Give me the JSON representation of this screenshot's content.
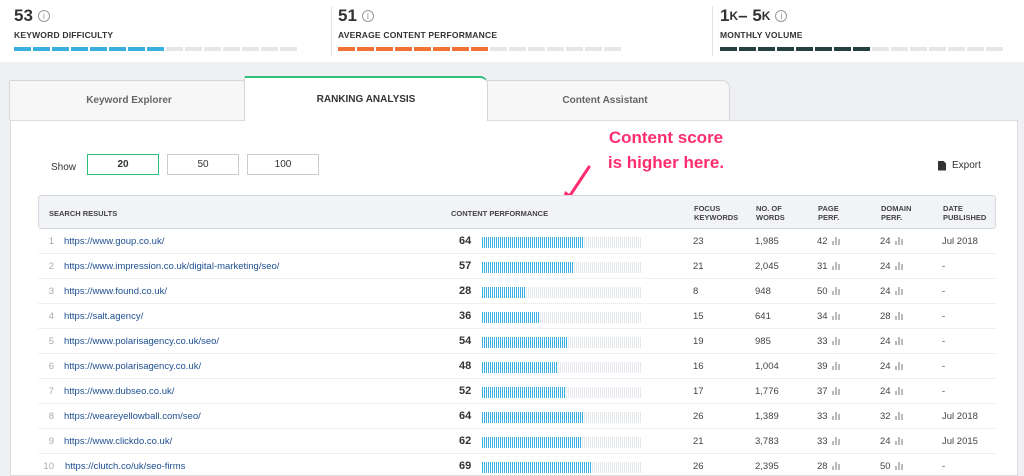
{
  "metrics": [
    {
      "value": "53",
      "label": "KEYWORD DIFFICULTY",
      "color": "#3ab0e0",
      "filled": 8,
      "total": 15
    },
    {
      "value": "51",
      "label": "AVERAGE CONTENT PERFORMANCE",
      "color": "#f07234",
      "filled": 8,
      "total": 15
    },
    {
      "value_main": "1",
      "value_unit_a": "K",
      "value_sep": " – 5",
      "value_unit_b": "K",
      "label": "MONTHLY VOLUME",
      "color": "#254143",
      "filled": 8,
      "total": 15
    }
  ],
  "tabs": {
    "keyword_explorer": "Keyword Explorer",
    "ranking_analysis": "RANKING ANALYSIS",
    "content_assistant": "Content Assistant"
  },
  "show": {
    "label": "Show",
    "options": [
      "20",
      "50",
      "100"
    ],
    "selected": "20"
  },
  "export_label": "Export",
  "annotation": {
    "line1": "Content score",
    "line2": "is higher here."
  },
  "columns": {
    "search_results": "SEARCH RESULTS",
    "content_performance": "CONTENT PERFORMANCE",
    "focus_keywords": "FOCUS KEYWORDS",
    "no_of_words": "NO. OF WORDS",
    "page_perf": "PAGE PERF.",
    "domain_perf": "DOMAIN PERF.",
    "date_published": "DATE PUBLISHED"
  },
  "colors": {
    "accent": "#2ebd7b",
    "bar": "#3ab0e0",
    "bar_empty": "#e4e8ec",
    "annotation": "#ff2d6f"
  },
  "rows": [
    {
      "rank": "1",
      "url": "https://www.goup.co.uk/",
      "score": "64",
      "focus": "23",
      "words": "1,985",
      "page": "42",
      "domain": "24",
      "date": "Jul 2018"
    },
    {
      "rank": "2",
      "url": "https://www.impression.co.uk/digital-marketing/seo/",
      "score": "57",
      "focus": "21",
      "words": "2,045",
      "page": "31",
      "domain": "24",
      "date": "-"
    },
    {
      "rank": "3",
      "url": "https://www.found.co.uk/",
      "score": "28",
      "focus": "8",
      "words": "948",
      "page": "50",
      "domain": "24",
      "date": "-"
    },
    {
      "rank": "4",
      "url": "https://salt.agency/",
      "score": "36",
      "focus": "15",
      "words": "641",
      "page": "34",
      "domain": "28",
      "date": "-"
    },
    {
      "rank": "5",
      "url": "https://www.polarisagency.co.uk/seo/",
      "score": "54",
      "focus": "19",
      "words": "985",
      "page": "33",
      "domain": "24",
      "date": "-"
    },
    {
      "rank": "6",
      "url": "https://www.polarisagency.co.uk/",
      "score": "48",
      "focus": "16",
      "words": "1,004",
      "page": "39",
      "domain": "24",
      "date": "-"
    },
    {
      "rank": "7",
      "url": "https://www.dubseo.co.uk/",
      "score": "52",
      "focus": "17",
      "words": "1,776",
      "page": "37",
      "domain": "24",
      "date": "-"
    },
    {
      "rank": "8",
      "url": "https://weareyellowball.com/seo/",
      "score": "64",
      "focus": "26",
      "words": "1,389",
      "page": "33",
      "domain": "32",
      "date": "Jul 2018"
    },
    {
      "rank": "9",
      "url": "https://www.clickdo.co.uk/",
      "score": "62",
      "focus": "21",
      "words": "3,783",
      "page": "33",
      "domain": "24",
      "date": "Jul 2015"
    },
    {
      "rank": "10",
      "url": "https://clutch.co/uk/seo-firms",
      "score": "69",
      "focus": "26",
      "words": "2,395",
      "page": "28",
      "domain": "50",
      "date": "-"
    }
  ]
}
